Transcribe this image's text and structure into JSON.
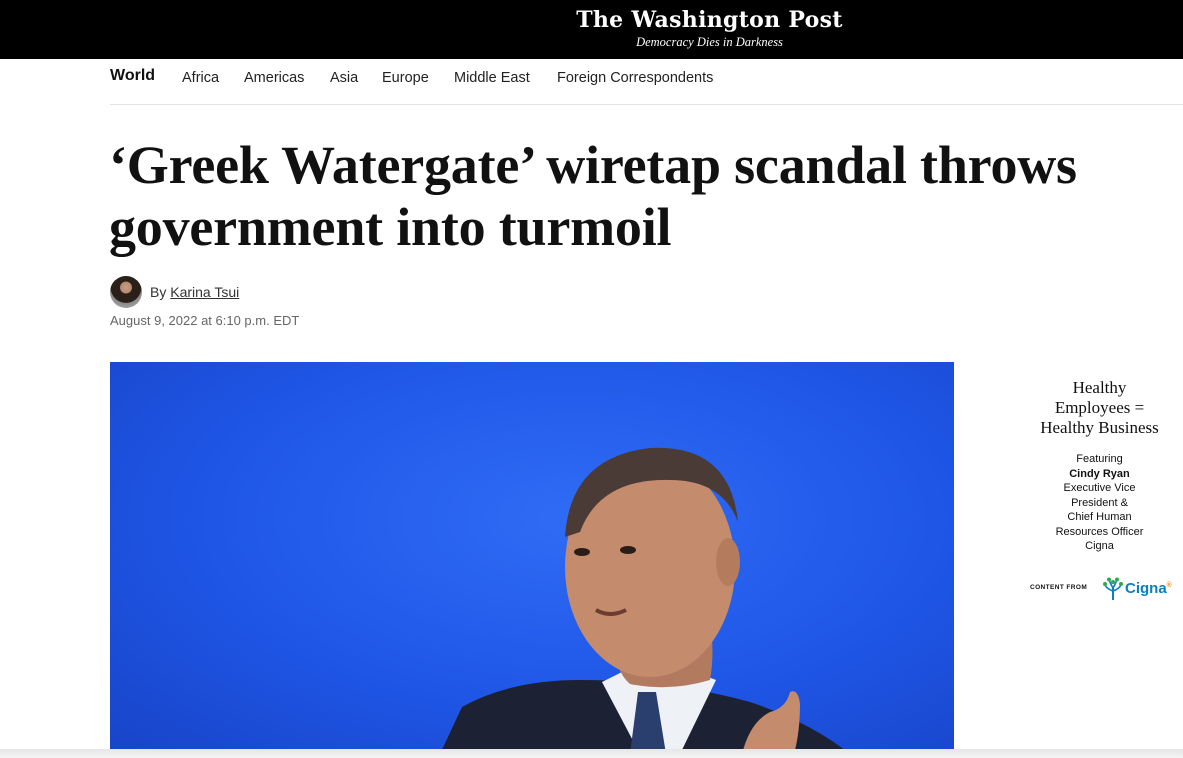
{
  "masthead": {
    "logo": "The Washington Post",
    "tagline": "Democracy Dies in Darkness"
  },
  "section_nav": {
    "current": "World",
    "items": [
      "Africa",
      "Americas",
      "Asia",
      "Europe",
      "Middle East",
      "Foreign Correspondents"
    ]
  },
  "article": {
    "headline_line1": "‘Greek Watergate’ wiretap scandal throws",
    "headline_line2": "government into turmoil",
    "byline_prefix": "By",
    "author": "Karina Tsui",
    "dateline": "August 9, 2022 at 6:10 p.m. EDT"
  },
  "ad": {
    "title_line1": "Healthy",
    "title_line2": "Employees =",
    "title_line3": "Healthy Business",
    "featuring": "Featuring",
    "name": "Cindy Ryan",
    "role_line1": "Executive Vice",
    "role_line2": "President &",
    "role_line3": "Chief Human",
    "role_line4": "Resources Officer",
    "company": "Cigna",
    "content_from": "CONTENT FROM",
    "sponsor": "Cigna",
    "sponsor_mark": "®"
  },
  "colors": {
    "masthead_bg": "#000000",
    "photo_bg": "#1f56e6",
    "cigna_blue": "#0a7fc2",
    "cigna_orange": "#f28c00"
  }
}
